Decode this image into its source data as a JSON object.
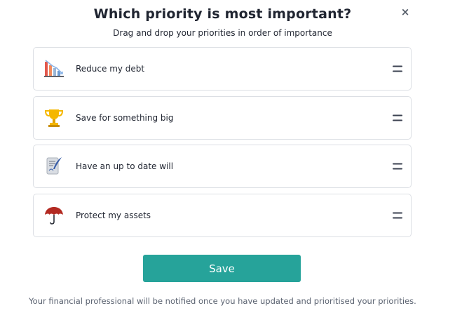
{
  "title": "Which priority is most important?",
  "close_glyph": "×",
  "subtitle": "Drag and drop your priorities in order of importance",
  "priorities": [
    {
      "label": "Reduce my debt",
      "icon": "debt-chart-icon"
    },
    {
      "label": "Save for something big",
      "icon": "trophy-icon"
    },
    {
      "label": "Have an up to date will",
      "icon": "scroll-quill-icon"
    },
    {
      "label": "Protect my assets",
      "icon": "umbrella-icon"
    }
  ],
  "save_label": "Save",
  "footer_text": "Your financial professional will be notified once you have updated and prioritised your priorities.",
  "colors": {
    "accent": "#26a39a",
    "border": "#dcdfe4",
    "text": "#1f2430"
  }
}
